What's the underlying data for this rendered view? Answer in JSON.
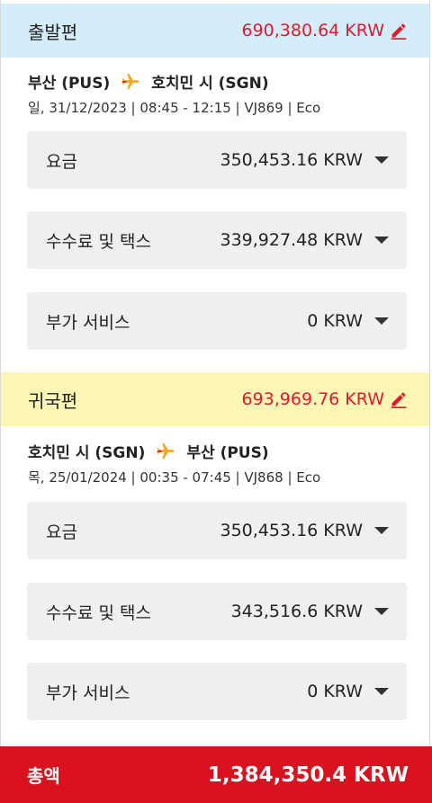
{
  "outbound": {
    "title": "출발편",
    "total": "690,380.64 KRW",
    "origin": "부산 (PUS)",
    "destination": "호치민 시 (SGN)",
    "info": "일, 31/12/2023 | 08:45 - 12:15 | VJ869 | Eco",
    "fare": {
      "label": "요금",
      "value": "350,453.16 KRW"
    },
    "fees": {
      "label": "수수료 및 택스",
      "value": "339,927.48 KRW"
    },
    "addons": {
      "label": "부가 서비스",
      "value": "0 KRW"
    }
  },
  "inbound": {
    "title": "귀국편",
    "total": "693,969.76 KRW",
    "origin": "호치민 시 (SGN)",
    "destination": "부산 (PUS)",
    "info": "목, 25/01/2024 | 00:35 - 07:45 | VJ868 | Eco",
    "fare": {
      "label": "요금",
      "value": "350,453.16 KRW"
    },
    "fees": {
      "label": "수수료 및 택스",
      "value": "343,516.6 KRW"
    },
    "addons": {
      "label": "부가 서비스",
      "value": "0 KRW"
    }
  },
  "grand_total": {
    "label": "총액",
    "value": "1,384,350.4 KRW"
  },
  "icons": {
    "edit": "pencil-edit-icon",
    "plane": "airplane-icon",
    "dropdown": "chevron-down-icon"
  },
  "colors": {
    "accent": "#e3182d",
    "outbound_bg": "#d4edfb",
    "inbound_bg": "#fdf7b6",
    "total_bg": "#d8131f",
    "row_bg": "#efefef"
  }
}
